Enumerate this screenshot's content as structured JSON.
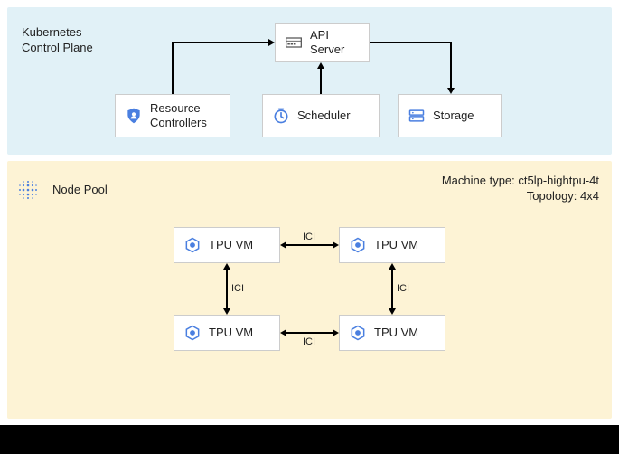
{
  "control_plane": {
    "title_line1": "Kubernetes",
    "title_line2": "Control Plane",
    "api_server_line1": "API",
    "api_server_line2": "Server",
    "resource_line1": "Resource",
    "resource_line2": "Controllers",
    "scheduler": "Scheduler",
    "storage": "Storage"
  },
  "node_pool": {
    "title": "Node Pool",
    "machine_type_label": "Machine type: ct5lp-hightpu-4t",
    "topology_label": "Topology: 4x4",
    "tpu_vm": "TPU VM",
    "ici": "ICI"
  },
  "chart_data": {
    "type": "diagram",
    "title": "Kubernetes Control Plane with TPU Node Pool",
    "sections": [
      {
        "name": "Kubernetes Control Plane",
        "nodes": [
          "API Server",
          "Resource Controllers",
          "Scheduler",
          "Storage"
        ],
        "edges": [
          {
            "from": "Resource Controllers",
            "to": "API Server",
            "direction": "one-way"
          },
          {
            "from": "Scheduler",
            "to": "API Server",
            "direction": "one-way"
          },
          {
            "from": "API Server",
            "to": "Storage",
            "direction": "one-way"
          }
        ]
      },
      {
        "name": "Node Pool",
        "attributes": {
          "machine_type": "ct5lp-hightpu-4t",
          "topology": "4x4"
        },
        "nodes": [
          "TPU VM 1",
          "TPU VM 2",
          "TPU VM 3",
          "TPU VM 4"
        ],
        "edges": [
          {
            "from": "TPU VM 1",
            "to": "TPU VM 2",
            "label": "ICI",
            "direction": "bidirectional"
          },
          {
            "from": "TPU VM 3",
            "to": "TPU VM 4",
            "label": "ICI",
            "direction": "bidirectional"
          },
          {
            "from": "TPU VM 1",
            "to": "TPU VM 3",
            "label": "ICI",
            "direction": "bidirectional"
          },
          {
            "from": "TPU VM 2",
            "to": "TPU VM 4",
            "label": "ICI",
            "direction": "bidirectional"
          }
        ]
      }
    ]
  }
}
